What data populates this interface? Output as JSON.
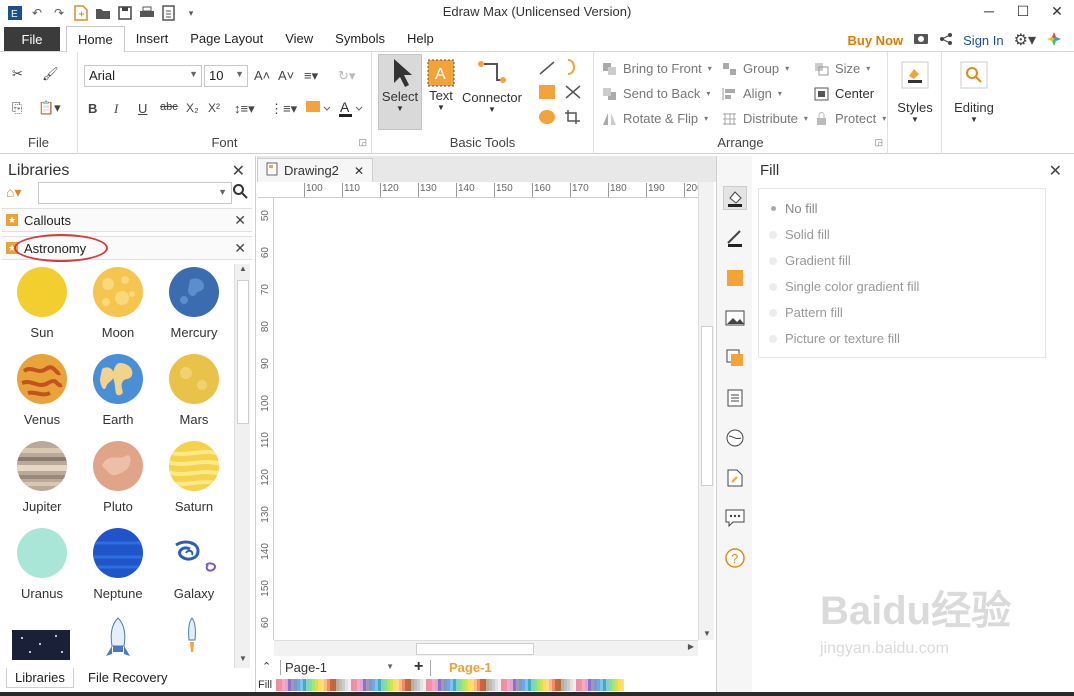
{
  "window": {
    "title": "Edraw Max (Unlicensed Version)"
  },
  "menubar": {
    "file": "File",
    "tabs": [
      "Home",
      "Insert",
      "Page Layout",
      "View",
      "Symbols",
      "Help"
    ],
    "active_tab": "Home",
    "buy_now": "Buy Now",
    "sign_in": "Sign In"
  },
  "ribbon": {
    "file_group": {
      "label": "File"
    },
    "font_group": {
      "label": "Font",
      "font_name": "Arial",
      "font_size": "10"
    },
    "basic_tools": {
      "label": "Basic Tools",
      "select": "Select",
      "text": "Text",
      "connector": "Connector"
    },
    "arrange": {
      "label": "Arrange",
      "bring_to_front": "Bring to Front",
      "send_to_back": "Send to Back",
      "rotate_flip": "Rotate & Flip",
      "group": "Group",
      "align": "Align",
      "distribute": "Distribute",
      "size": "Size",
      "center": "Center",
      "protect": "Protect"
    },
    "styles": "Styles",
    "editing": "Editing"
  },
  "libraries": {
    "title": "Libraries",
    "categories": [
      "Callouts",
      "Astronomy"
    ],
    "shapes": [
      {
        "name": "Sun"
      },
      {
        "name": "Moon"
      },
      {
        "name": "Mercury"
      },
      {
        "name": "Venus"
      },
      {
        "name": "Earth"
      },
      {
        "name": "Mars"
      },
      {
        "name": "Jupiter"
      },
      {
        "name": "Pluto"
      },
      {
        "name": "Saturn"
      },
      {
        "name": "Uranus"
      },
      {
        "name": "Neptune"
      },
      {
        "name": "Galaxy"
      }
    ],
    "bottom_tabs": [
      "Libraries",
      "File Recovery"
    ]
  },
  "document": {
    "tab": "Drawing2",
    "ruler_h": [
      "100",
      "110",
      "120",
      "130",
      "140",
      "150",
      "160",
      "170",
      "180",
      "190",
      "200"
    ],
    "ruler_v": [
      "50",
      "60",
      "70",
      "80",
      "90",
      "100",
      "110",
      "120",
      "130",
      "140",
      "150",
      "60"
    ],
    "page_select": "Page-1",
    "page_active": "Page-1",
    "fill_label": "Fill"
  },
  "fill_panel": {
    "title": "Fill",
    "options": [
      "No fill",
      "Solid fill",
      "Gradient fill",
      "Single color gradient fill",
      "Pattern fill",
      "Picture or texture fill"
    ],
    "selected": "No fill"
  },
  "watermark": {
    "brand": "Baidu经验",
    "url": "jingyan.baidu.com"
  },
  "colors": {
    "accent": "#e07b00",
    "file_btn": "#3b3b3b",
    "link": "#1a4f9c",
    "page_active": "#f0a030"
  }
}
